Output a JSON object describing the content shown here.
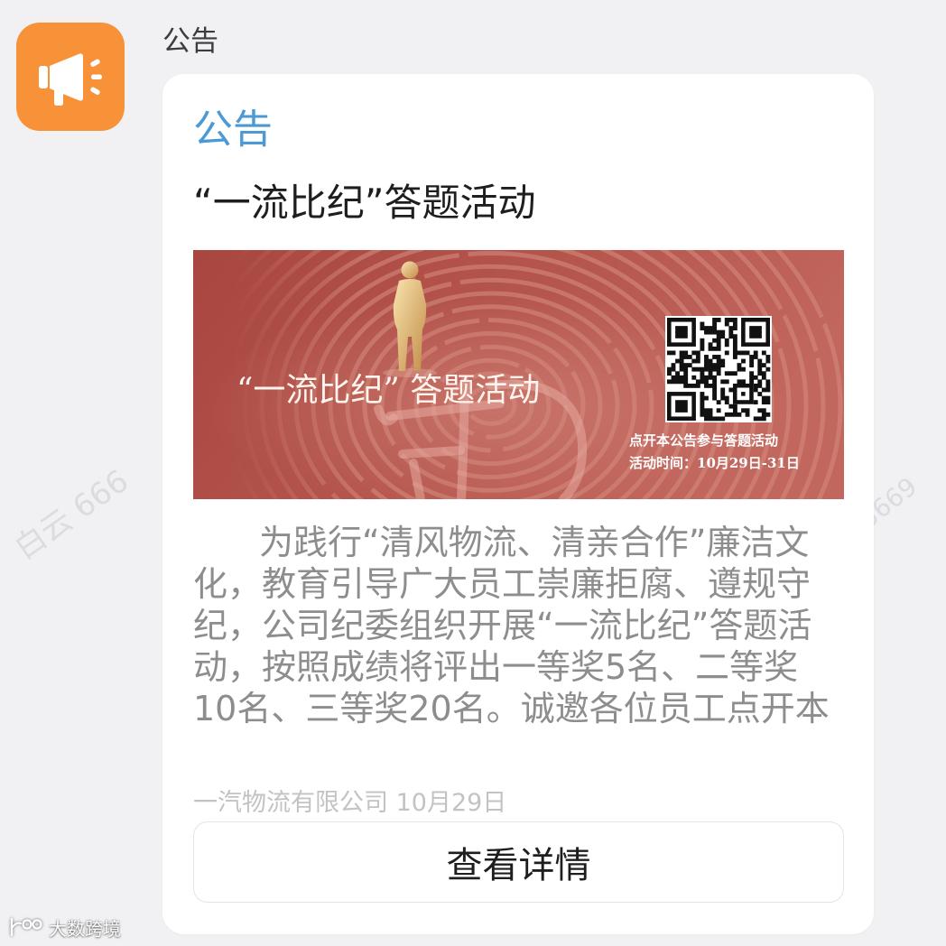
{
  "sender": {
    "name": "公告"
  },
  "card": {
    "tag": "公告",
    "title": "“一流比纪”答题活动",
    "banner": {
      "headline": "“一流比纪” 答题活动",
      "cta": "点开本公告参与答题活动",
      "period": "活动时间：10月29日-31日"
    },
    "body_lines": [
      "为践行“清风物流、清亲合作”廉洁文",
      "化，教育引导广大员工崇廉拒腐、遵规守",
      "纪，公司纪委组织开展“一流比纪”答题活",
      "动，按照成绩将评出一等奖5名、二等奖",
      "10名、三等奖20名。诚邀各位员工点开本"
    ],
    "footer": "一汽物流有限公司 10月29日",
    "button_label": "查看详情"
  },
  "watermark": {
    "left": "白云 666",
    "right": "5669",
    "corner": "大数跨境"
  },
  "icons": {
    "app_icon": "megaphone-icon",
    "corner_logo": "brand-logo-icon",
    "banner_code": "qr-code"
  },
  "colors": {
    "page_bg": "#f1f1f3",
    "card_bg": "#ffffff",
    "accent": "#4b9ad5",
    "icon_bg": "#f79239",
    "banner_bg": "#b5564d",
    "body_text": "#8d8d8d",
    "footer_text": "#c3c3c3"
  }
}
